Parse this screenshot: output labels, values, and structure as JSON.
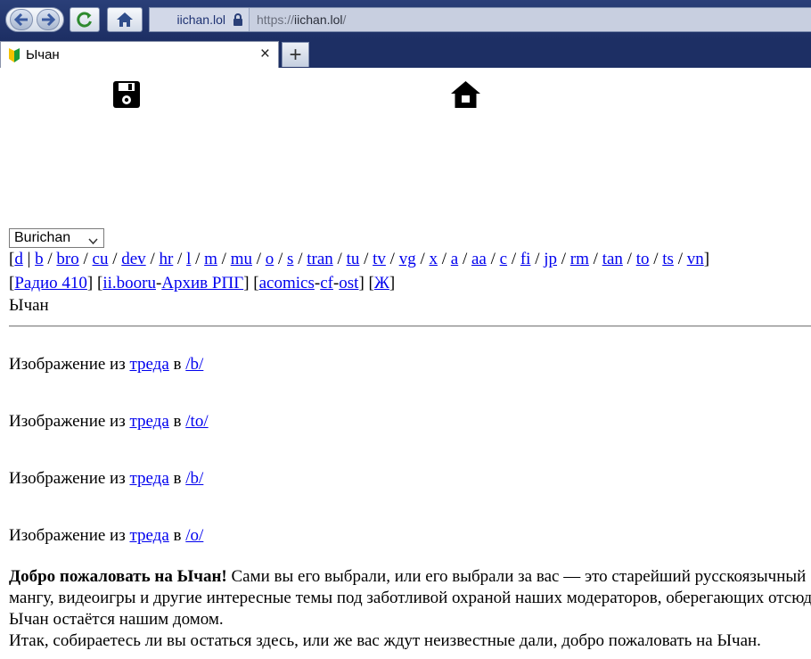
{
  "browser": {
    "site_identity": "iichan.lol",
    "url_scheme": "https://",
    "url_host": "iichan.lol",
    "url_path": "/",
    "tab_title": "Ычан",
    "new_tab_label": "+",
    "close_label": "×"
  },
  "page": {
    "style_select": {
      "value": "Burichan"
    },
    "boards": [
      "d",
      "b",
      "bro",
      "cu",
      "dev",
      "hr",
      "l",
      "m",
      "mu",
      "o",
      "s",
      "tran",
      "tu",
      "tv",
      "vg",
      "x",
      "a",
      "aa",
      "c",
      "fi",
      "jp",
      "rm",
      "tan",
      "to",
      "ts",
      "vn"
    ],
    "extra_links": {
      "radio": "Радио 410",
      "booru": "ii.booru",
      "rpg": "Архив РПГ",
      "acomics": "acomics",
      "cf": "cf",
      "ost": "ost",
      "x": "Ж"
    },
    "site_name": "Ычан",
    "images": [
      {
        "prefix": "Изображение из",
        "link": "треда",
        "mid": "в",
        "board": "/b/"
      },
      {
        "prefix": "Изображение из",
        "link": "треда",
        "mid": "в",
        "board": "/to/"
      },
      {
        "prefix": "Изображение из",
        "link": "треда",
        "mid": "в",
        "board": "/b/"
      },
      {
        "prefix": "Изображение из",
        "link": "треда",
        "mid": "в",
        "board": "/o/"
      }
    ],
    "welcome": {
      "bold": "Добро пожаловать на Ычан!",
      "line1_rest": " Сами вы его выбрали, или его выбрали за вас — это старейший русскоязычный",
      "line2": "мангу, видеоигры и другие интересные темы под заботливой охраной наших модераторов, оберегающих отсюда",
      "line3": "Ычан остаётся нашим домом.",
      "line4": "Итак, собираетесь ли вы остаться здесь, или же вас ждут неизвестные дали, добро пожаловать на Ычан."
    }
  },
  "colors": {
    "link": "#0000ee",
    "chrome": "#1d2f64"
  }
}
